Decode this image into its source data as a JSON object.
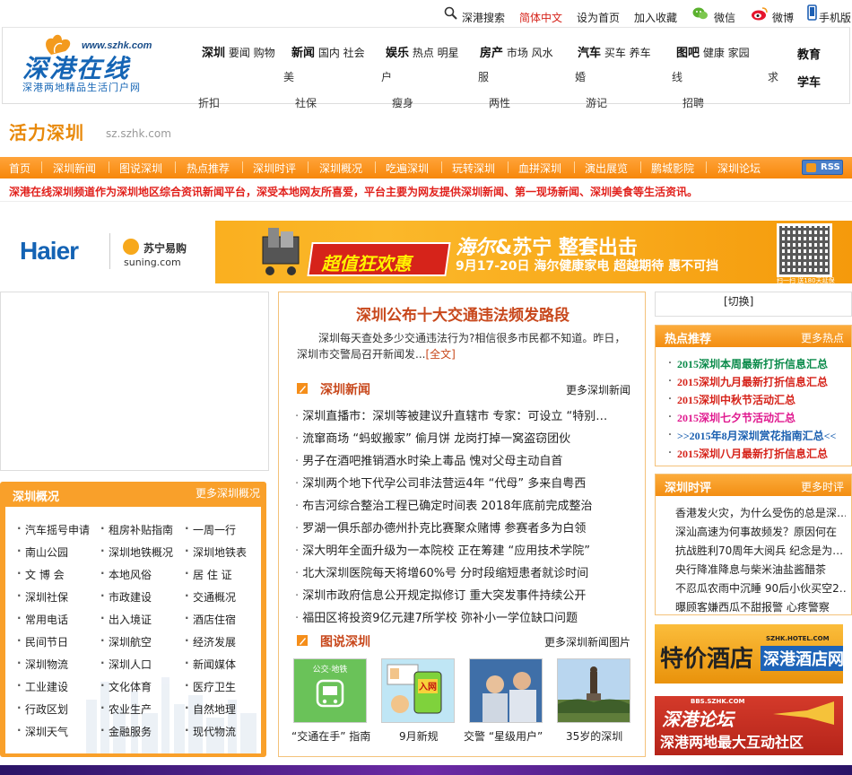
{
  "topbar": {
    "search": "深港搜索",
    "lang": "简体中文",
    "homepage": "设为首页",
    "favorite": "加入收藏",
    "weixin": "微信",
    "weibo": "微博",
    "mobile": "手机版"
  },
  "logo": {
    "url": "www.szhk.com",
    "name": "深港在线",
    "slogan": "深港两地精品生活门户网"
  },
  "mainnav": {
    "row1": [
      {
        "head": "深圳",
        "links": "要闻 购物"
      },
      {
        "head": "新闻",
        "links": "国内 社会"
      },
      {
        "head": "娱乐",
        "links": "热点 明星"
      },
      {
        "head": "房产",
        "links": "市场 风水"
      },
      {
        "head": "汽车",
        "links": "买车 养车"
      },
      {
        "head": "图吧",
        "links": "健康 家园"
      },
      {
        "head": "教育",
        "links": ""
      }
    ],
    "row2": [
      "美",
      "户",
      "服",
      "婚",
      "线",
      "求",
      "学车"
    ],
    "row3": [
      "折扣",
      "社保",
      "瘦身",
      "两性",
      "游记",
      "招聘"
    ]
  },
  "channel": {
    "title": "活力深圳",
    "domain": "sz.szhk.com"
  },
  "subnav": [
    "首页",
    "深圳新闻",
    "图说深圳",
    "热点推荐",
    "深圳时评",
    "深圳概况",
    "吃遍深圳",
    "玩转深圳",
    "血拼深圳",
    "演出展览",
    "鹏城影院",
    "深圳论坛"
  ],
  "rss": "RSS",
  "intro": "深港在线深圳频道作为深圳地区综合资讯新闻平台，深受本地网友所喜爱，平台主要为网友提供深圳新闻、第一现场新闻、深圳美食等生活资讯。",
  "banner": {
    "brand1": "Haier",
    "brand2": "苏宁易购",
    "brand2_en": "suning.com",
    "badge": "超值狂欢惠",
    "headline": "&苏宁 整套出击",
    "headline_script": "海尔",
    "date_line": "9月17-20日 海尔健康家电 超越期待 惠不可挡",
    "qr_caption": "扫一扫 送180天延保"
  },
  "overview": {
    "title": "深圳概况",
    "more": "更多深圳概况",
    "items": [
      [
        "汽车摇号申请",
        "租房补贴指南",
        "一周一行"
      ],
      [
        "南山公园",
        "深圳地铁概况",
        "深圳地铁表"
      ],
      [
        "文 博 会",
        "本地风俗",
        "居 住 证"
      ],
      [
        "深圳社保",
        "市政建设",
        "交通概况"
      ],
      [
        "常用电话",
        "出入境证",
        "酒店住宿"
      ],
      [
        "民间节日",
        "深圳航空",
        "经济发展"
      ],
      [
        "深圳物流",
        "深圳人口",
        "新闻媒体"
      ],
      [
        "工业建设",
        "文化体育",
        "医疗卫生"
      ],
      [
        "行政区划",
        "农业生产",
        "自然地理"
      ],
      [
        "深圳天气",
        "金融服务",
        "现代物流"
      ]
    ]
  },
  "headline": {
    "title": "深圳公布十大交通违法频发路段",
    "lead": "深圳每天查处多少交通违法行为?相信很多市民都不知道。昨日，深圳市交警局召开新闻发...",
    "full": "[全文]"
  },
  "news": {
    "title": "深圳新闻",
    "more": "更多深圳新闻",
    "items": [
      "深圳直播市：深圳等被建议升直辖市 专家：可设立 “特别…",
      "流窜商场 “蚂蚁搬家” 偷月饼 龙岗打掉一窝盗窃团伙",
      "男子在酒吧推销酒水时染上毒品 愧对父母主动自首",
      "深圳两个地下代孕公司非法营运4年 “代母” 多来自粤西",
      "布吉河综合整治工程已确定时间表 2018年底前完成整治",
      "罗湖一俱乐部办德州扑克比赛聚众赌博 参赛者多为白领",
      "深大明年全面升级为一本院校 正在筹建 “应用技术学院”",
      "北大深圳医院每天将增60%号 分时段缩短患者就诊时间",
      "深圳市政府信息公开规定拟修订 重大突发事件持续公开",
      "福田区将投资9亿元建7所学校 弥补小一学位缺口问题"
    ]
  },
  "photos": {
    "title": "图说深圳",
    "more": "更多深圳新闻图片",
    "items": [
      {
        "caption": "“交通在手” 指南",
        "tag": "公交·地铁"
      },
      {
        "caption": "9月新规",
        "tag": "入网"
      },
      {
        "caption": "交警 “星级用户”",
        "tag": ""
      },
      {
        "caption": "35岁的深圳",
        "tag": ""
      }
    ]
  },
  "switch": "[切换]",
  "hot": {
    "title": "热点推荐",
    "more": "更多热点",
    "items": [
      {
        "text": "2015深圳本周最新打折信息汇总",
        "color": "#0a8a4a"
      },
      {
        "text": "2015深圳九月最新打折信息汇总",
        "color": "#d6231a"
      },
      {
        "text": "2015深圳中秋节活动汇总",
        "color": "#d6231a"
      },
      {
        "text": "2015深圳七夕节活动汇总",
        "color": "#e0198f"
      },
      {
        "text": ">>2015年8月深圳赏花指南汇总<<",
        "color": "#1a5fb0"
      },
      {
        "text": "2015深圳八月最新打折信息汇总",
        "color": "#d6231a"
      }
    ]
  },
  "comment": {
    "title": "深圳时评",
    "more": "更多时评",
    "items": [
      "香港发火灾，为什么受伤的总是深…",
      "深汕高速为何事故频发？原因何在",
      "抗战胜利70周年大阅兵 纪念是为…",
      "央行降准降息与柴米油盐酱醋茶",
      "不忍瓜农雨中沉睡 90后小伙买空2…",
      "曝顾客嫌西瓜不甜报警 心疼警察"
    ]
  },
  "ads": {
    "hotel_main": "特价酒店",
    "hotel_site": "深港酒店网",
    "hotel_url": "SZHK.HOTEL.COM",
    "forum_url": "BBS.SZHK.COM",
    "forum_name": "深港论坛",
    "forum_slogan": "深港两地最大互动社区"
  }
}
